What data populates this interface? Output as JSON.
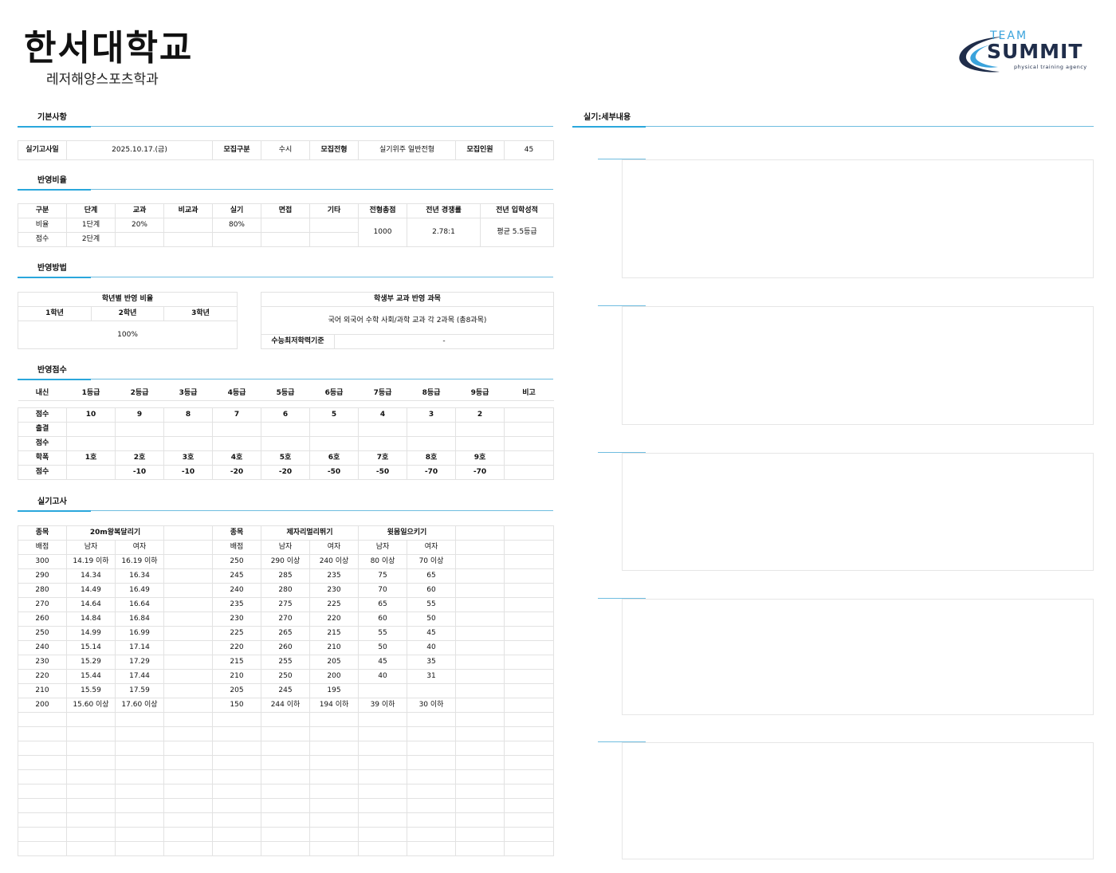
{
  "header": {
    "title": "한서대학교",
    "subtitle": "레저해양스포츠학과",
    "logo_text": "TEAM SUMMIT physical training agency"
  },
  "sections": {
    "basic": "기본사항",
    "ratio": "반영비율",
    "method": "반영방법",
    "score": "반영점수",
    "practical": "실기고사",
    "detail": "실기:세부내용"
  },
  "basic": {
    "date_label": "실기고사일",
    "date": "2025.10.17.(금)",
    "type_label": "모집구분",
    "type": "수시",
    "track_label": "모집전형",
    "track": "실기위주 일반전형",
    "count_label": "모집인원",
    "count": "45"
  },
  "ratio": {
    "headers": [
      "구분",
      "단계",
      "교과",
      "비교과",
      "실기",
      "면접",
      "기타",
      "전형총점",
      "전년 경쟁률",
      "전년 입학성적"
    ],
    "rows": [
      [
        "비율",
        "1단계",
        "20%",
        "",
        "80%",
        "",
        ""
      ],
      [
        "점수",
        "2단계",
        "",
        "",
        "",
        "",
        ""
      ]
    ],
    "total": "1000",
    "competition": "2.78:1",
    "prev_score": "평균 5.5등급"
  },
  "method": {
    "grade_title": "학년별 반영 비율",
    "grades": [
      "1학년",
      "2학년",
      "3학년"
    ],
    "grade_value": "100%",
    "subject_title": "학생부 교과 반영 과목",
    "subjects": "국어 외국어 수학 사회/과학 교과 각 2과목 (총8과목)",
    "min_label": "수능최저학력기준",
    "min_value": "-"
  },
  "score": {
    "headers": [
      "내신",
      "1등급",
      "2등급",
      "3등급",
      "4등급",
      "5등급",
      "6등급",
      "7등급",
      "8등급",
      "9등급",
      "비고"
    ],
    "rows": [
      [
        "점수",
        "10",
        "9",
        "8",
        "7",
        "6",
        "5",
        "4",
        "3",
        "2",
        ""
      ],
      [
        "출결",
        "",
        "",
        "",
        "",
        "",
        "",
        "",
        "",
        "",
        ""
      ],
      [
        "점수",
        "",
        "",
        "",
        "",
        "",
        "",
        "",
        "",
        "",
        ""
      ],
      [
        "학폭",
        "1호",
        "2호",
        "3호",
        "4호",
        "5호",
        "6호",
        "7호",
        "8호",
        "9호",
        ""
      ],
      [
        "점수",
        "",
        "-10",
        "-10",
        "-20",
        "-20",
        "-50",
        "-50",
        "-70",
        "-70",
        ""
      ]
    ]
  },
  "practical": {
    "header": [
      "종목",
      "20m왕복달리기",
      "",
      "종목",
      "제자리멀리뛰기",
      "윗몸일으키기"
    ],
    "sub": [
      "배점",
      "남자",
      "여자",
      "",
      "배점",
      "남자",
      "여자",
      "남자",
      "여자",
      "",
      ""
    ],
    "rows": [
      [
        "300",
        "14.19 이하",
        "16.19 이하",
        "",
        "250",
        "290 이상",
        "240 이상",
        "80 이상",
        "70 이상",
        "",
        ""
      ],
      [
        "290",
        "14.34",
        "16.34",
        "",
        "245",
        "285",
        "235",
        "75",
        "65",
        "",
        ""
      ],
      [
        "280",
        "14.49",
        "16.49",
        "",
        "240",
        "280",
        "230",
        "70",
        "60",
        "",
        ""
      ],
      [
        "270",
        "14.64",
        "16.64",
        "",
        "235",
        "275",
        "225",
        "65",
        "55",
        "",
        ""
      ],
      [
        "260",
        "14.84",
        "16.84",
        "",
        "230",
        "270",
        "220",
        "60",
        "50",
        "",
        ""
      ],
      [
        "250",
        "14.99",
        "16.99",
        "",
        "225",
        "265",
        "215",
        "55",
        "45",
        "",
        ""
      ],
      [
        "240",
        "15.14",
        "17.14",
        "",
        "220",
        "260",
        "210",
        "50",
        "40",
        "",
        ""
      ],
      [
        "230",
        "15.29",
        "17.29",
        "",
        "215",
        "255",
        "205",
        "45",
        "35",
        "",
        ""
      ],
      [
        "220",
        "15.44",
        "17.44",
        "",
        "210",
        "250",
        "200",
        "40",
        "31",
        "",
        ""
      ],
      [
        "210",
        "15.59",
        "17.59",
        "",
        "205",
        "245",
        "195",
        "",
        "",
        "",
        ""
      ],
      [
        "200",
        "15.60 이상",
        "17.60 이상",
        "",
        "150",
        "244 이하",
        "194 이하",
        "39 이하",
        "30 이하",
        "",
        ""
      ]
    ],
    "empty_rows": 10
  }
}
